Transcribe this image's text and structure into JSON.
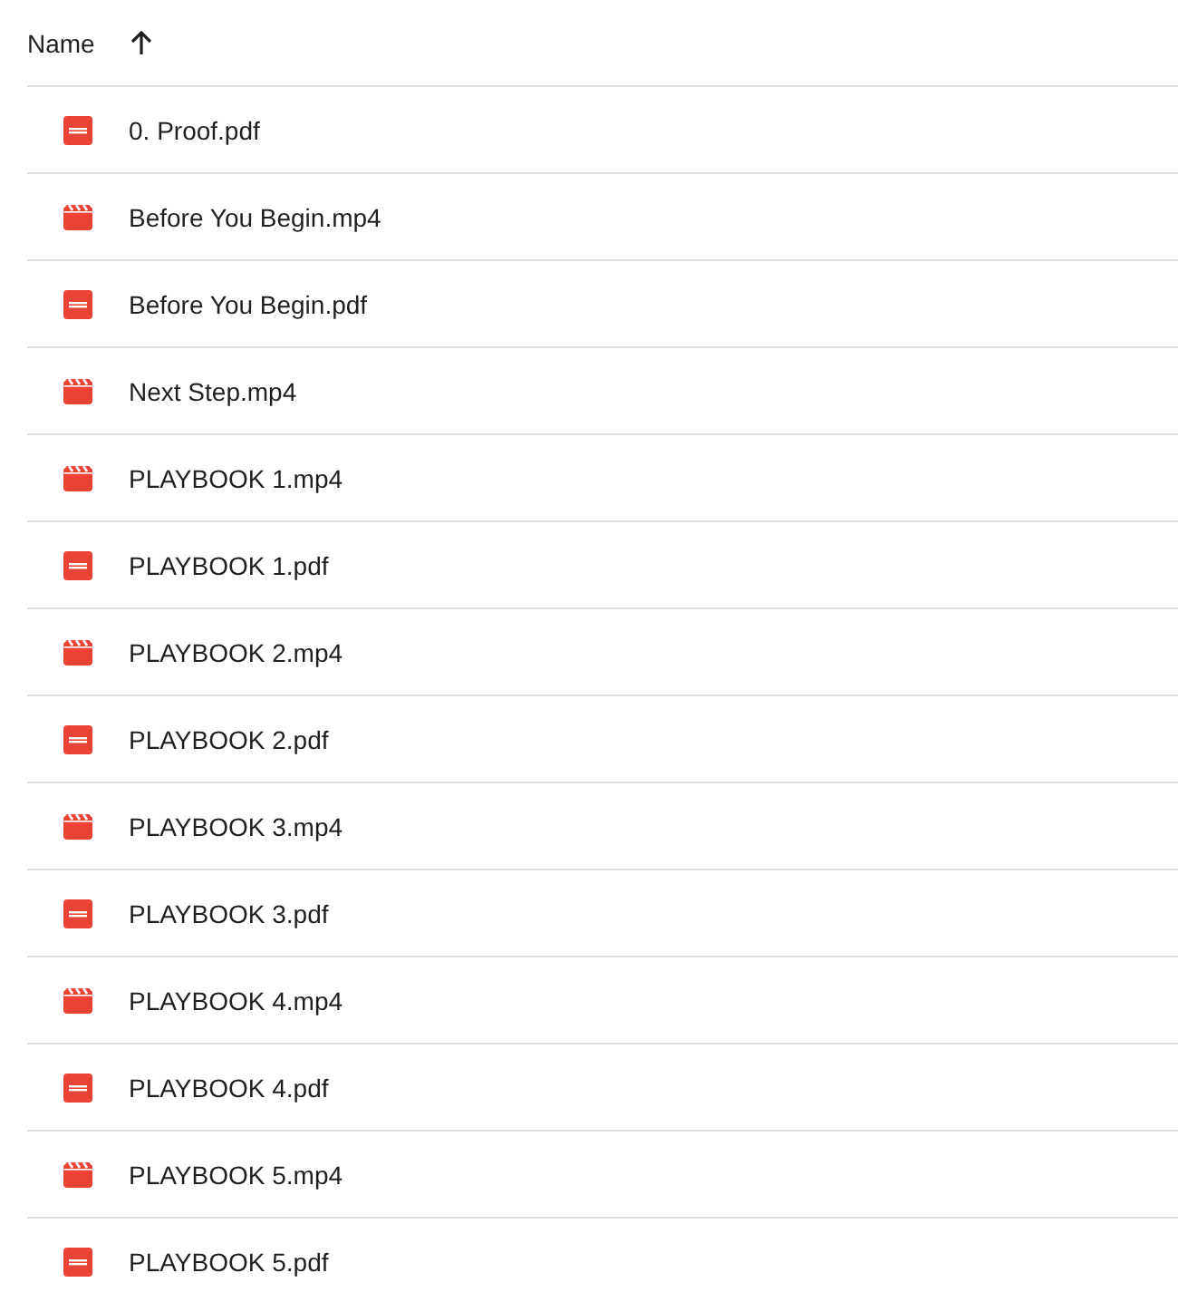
{
  "header": {
    "label": "Name",
    "sort_ascending": true
  },
  "files": [
    {
      "name": "0. Proof.pdf",
      "kind": "pdf"
    },
    {
      "name": "Before You Begin.mp4",
      "kind": "video"
    },
    {
      "name": "Before You Begin.pdf",
      "kind": "pdf"
    },
    {
      "name": "Next Step.mp4",
      "kind": "video"
    },
    {
      "name": "PLAYBOOK 1.mp4",
      "kind": "video"
    },
    {
      "name": "PLAYBOOK 1.pdf",
      "kind": "pdf"
    },
    {
      "name": "PLAYBOOK 2.mp4",
      "kind": "video"
    },
    {
      "name": "PLAYBOOK 2.pdf",
      "kind": "pdf"
    },
    {
      "name": "PLAYBOOK 3.mp4",
      "kind": "video"
    },
    {
      "name": "PLAYBOOK 3.pdf",
      "kind": "pdf"
    },
    {
      "name": "PLAYBOOK 4.mp4",
      "kind": "video"
    },
    {
      "name": "PLAYBOOK 4.pdf",
      "kind": "pdf"
    },
    {
      "name": "PLAYBOOK 5.mp4",
      "kind": "video"
    },
    {
      "name": "PLAYBOOK 5.pdf",
      "kind": "pdf"
    }
  ]
}
